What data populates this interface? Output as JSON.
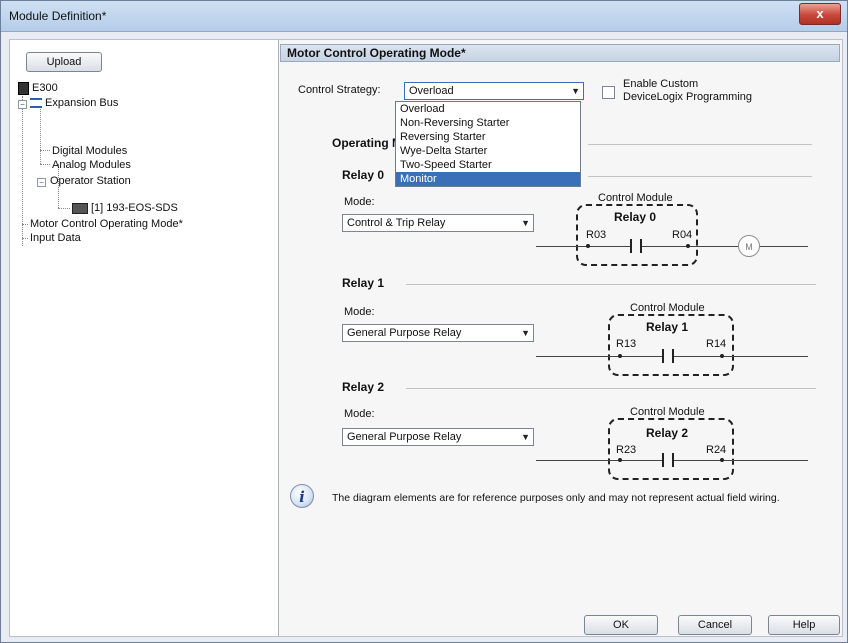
{
  "window": {
    "title": "Module Definition*",
    "close_label": "x"
  },
  "left": {
    "upload_label": "Upload",
    "tree": [
      {
        "label": "E300",
        "icon": "device-icon"
      },
      {
        "label": "Expansion Bus",
        "icon": "network-icon"
      },
      {
        "label": "Digital Modules"
      },
      {
        "label": "Analog Modules"
      },
      {
        "label": "Operator Station"
      },
      {
        "label": "[1] 193-EOS-SDS",
        "icon": "station-icon"
      },
      {
        "label": "Motor Control Operating Mode*"
      },
      {
        "label": "Input Data"
      }
    ]
  },
  "main": {
    "header": "Motor Control Operating Mode*",
    "control_strategy_label": "Control Strategy:",
    "control_strategy_value": "Overload",
    "enable_custom_line1": "Enable Custom",
    "enable_custom_line2": "DeviceLogix Programming",
    "operating_modes_heading": "Operating M",
    "dropdown_options": [
      "Overload",
      "Non-Reversing Starter",
      "Reversing Starter",
      "Wye-Delta Starter",
      "Two-Speed Starter",
      "Monitor"
    ],
    "dropdown_highlighted": "Monitor",
    "relays": [
      {
        "title": "Relay 0",
        "mode_label": "Mode:",
        "mode_value": "Control & Trip Relay",
        "module_label": "Control Module",
        "module_relay": "Relay 0",
        "terminal_a": "R03",
        "terminal_b": "R04",
        "motor_label": "M"
      },
      {
        "title": "Relay 1",
        "mode_label": "Mode:",
        "mode_value": "General Purpose Relay",
        "module_label": "Control Module",
        "module_relay": "Relay 1",
        "terminal_a": "R13",
        "terminal_b": "R14"
      },
      {
        "title": "Relay 2",
        "mode_label": "Mode:",
        "mode_value": "General Purpose Relay",
        "module_label": "Control Module",
        "module_relay": "Relay 2",
        "terminal_a": "R23",
        "terminal_b": "R24"
      }
    ],
    "info_text": "The diagram elements are for reference purposes only and may not represent actual field wiring."
  },
  "buttons": {
    "ok": "OK",
    "cancel": "Cancel",
    "help": "Help"
  },
  "colors": {
    "selection": "#3b70b8",
    "header_bg": "#c6d3e3",
    "close_red": "#c8473a"
  }
}
